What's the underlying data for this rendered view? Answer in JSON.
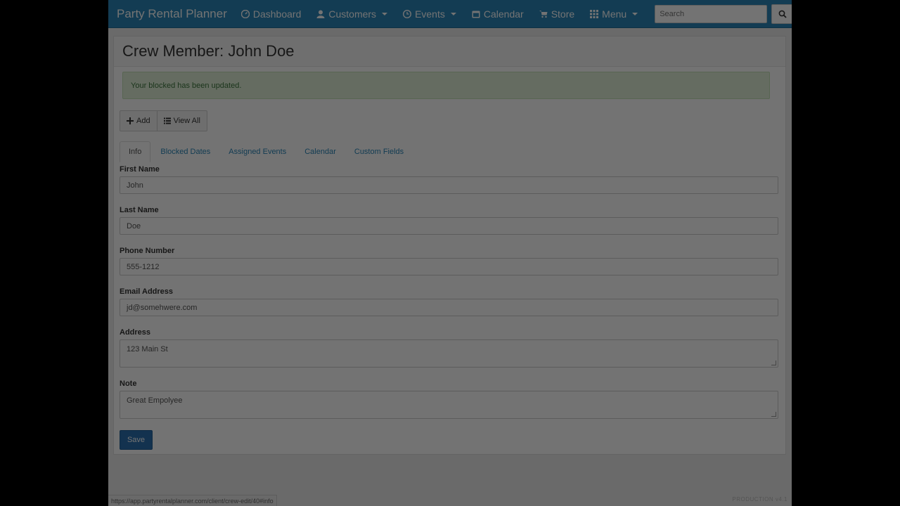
{
  "navbar": {
    "brand": "Party Rental Planner",
    "items": [
      {
        "label": "Dashboard",
        "icon": "dashboard-icon",
        "dropdown": false
      },
      {
        "label": "Customers",
        "icon": "user-icon",
        "dropdown": true
      },
      {
        "label": "Events",
        "icon": "clock-icon",
        "dropdown": true
      },
      {
        "label": "Calendar",
        "icon": "calendar-icon",
        "dropdown": false
      },
      {
        "label": "Store",
        "icon": "cart-icon",
        "dropdown": false
      },
      {
        "label": "Menu",
        "icon": "grid-icon",
        "dropdown": true
      }
    ],
    "search_placeholder": "Search"
  },
  "page": {
    "title": "Crew Member: John Doe",
    "alert": "Your blocked has been updated.",
    "buttons": {
      "add": "Add",
      "view_all": "View All"
    },
    "tabs": [
      {
        "label": "Info",
        "active": true
      },
      {
        "label": "Blocked Dates",
        "active": false
      },
      {
        "label": "Assigned Events",
        "active": false
      },
      {
        "label": "Calendar",
        "active": false
      },
      {
        "label": "Custom Fields",
        "active": false
      }
    ]
  },
  "form": {
    "first_name": {
      "label": "First Name",
      "value": "John"
    },
    "last_name": {
      "label": "Last Name",
      "value": "Doe"
    },
    "phone": {
      "label": "Phone Number",
      "value": "555-1212"
    },
    "email": {
      "label": "Email Address",
      "value": "jd@somehwere.com"
    },
    "address": {
      "label": "Address",
      "value": "123 Main St"
    },
    "note": {
      "label": "Note",
      "value": "Great Empolyee"
    },
    "save_label": "Save"
  },
  "status_url": "https://app.partyrentalplanner.com/client/crew-edit/40#info",
  "version": "PRODUCTION v4.1",
  "colors": {
    "navbar": "#2a86b8",
    "alert_bg": "#dff0d8",
    "save_button": "#2a6fb0"
  }
}
